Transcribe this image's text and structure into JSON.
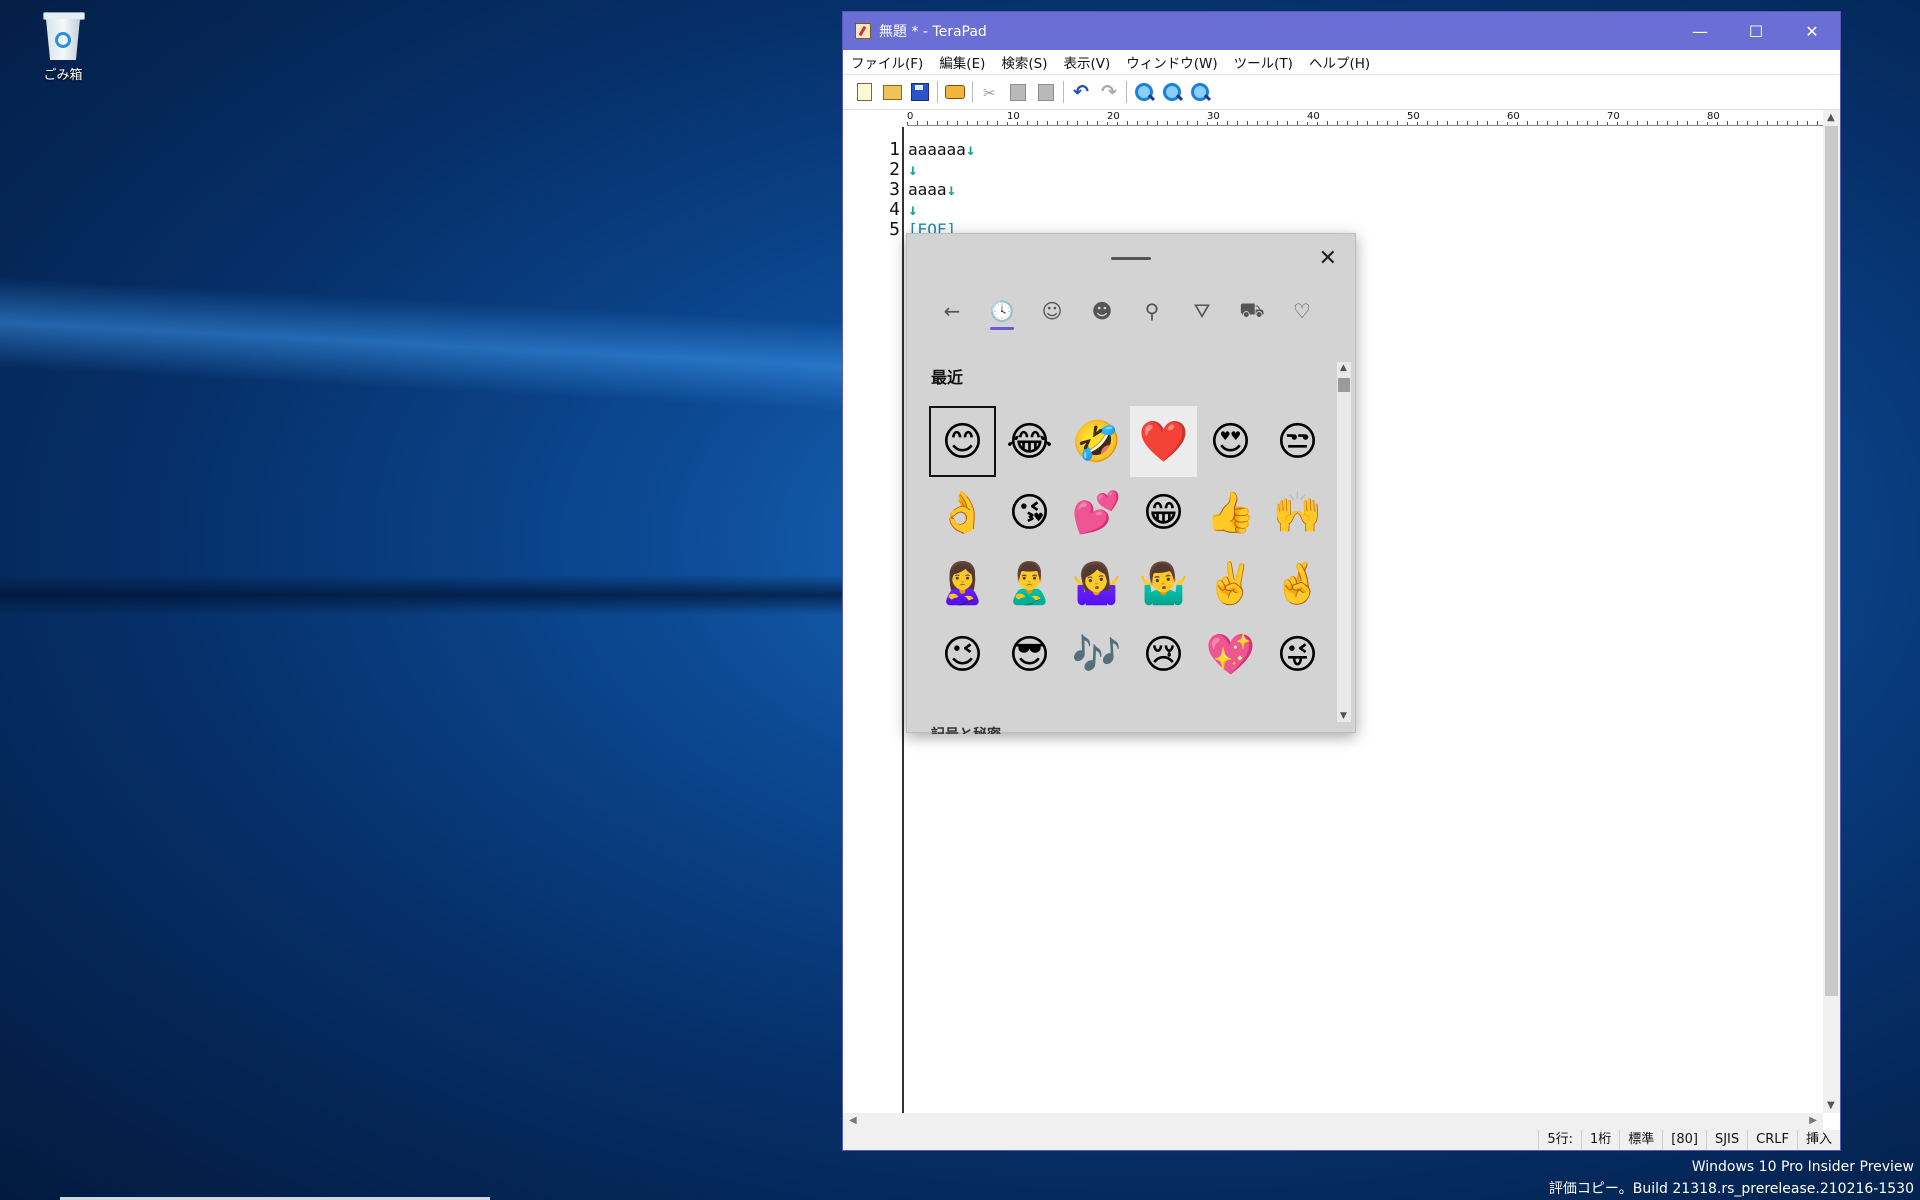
{
  "desktop": {
    "recycle_bin_label": "ごみ箱",
    "watermark_line1": "Windows 10 Pro Insider Preview",
    "watermark_line2": "評価コピー。Build 21318.rs_prerelease.210216-1530"
  },
  "window": {
    "title": "無題 * - TeraPad",
    "controls": {
      "minimize": "—",
      "maximize": "☐",
      "close": "✕"
    }
  },
  "menu": [
    "ファイル(F)",
    "編集(E)",
    "検索(S)",
    "表示(V)",
    "ウィンドウ(W)",
    "ツール(T)",
    "ヘルプ(H)"
  ],
  "ruler_ticks": [
    "0",
    "10",
    "20",
    "30",
    "40",
    "50",
    "60",
    "70",
    "80"
  ],
  "editor": {
    "line_numbers": [
      "1",
      "2",
      "3",
      "4",
      "5"
    ],
    "lines": [
      {
        "text": "aaaaaa",
        "newline": "↓"
      },
      {
        "text": "",
        "newline": "↓"
      },
      {
        "text": "aaaa",
        "newline": "↓"
      },
      {
        "text": "",
        "newline": "↓"
      }
    ],
    "eof": "[EOF]"
  },
  "emoji_panel": {
    "close_glyph": "✕",
    "tabs": [
      {
        "name": "back-arrow-icon",
        "glyph": "←"
      },
      {
        "name": "recent-clock-icon",
        "glyph": "🕓"
      },
      {
        "name": "smiley-icon",
        "glyph": "☺"
      },
      {
        "name": "people-icon",
        "glyph": "☻"
      },
      {
        "name": "celebration-icon",
        "glyph": "⚲"
      },
      {
        "name": "food-icon",
        "glyph": "⛛"
      },
      {
        "name": "car-icon",
        "glyph": "⛟"
      },
      {
        "name": "heart-icon",
        "glyph": "♡"
      }
    ],
    "section_title": "最近",
    "next_section_title": "記号と秘密",
    "emojis": [
      "😊",
      "😂",
      "🤣",
      "❤️",
      "😍",
      "😒",
      "👌",
      "😘",
      "💕",
      "😁",
      "👍",
      "🙌",
      "🙎‍♀️",
      "🙎‍♂️",
      "🤷‍♀️",
      "🤷‍♂️",
      "✌️",
      "🤞",
      "😉",
      "😎",
      "🎶",
      "😢",
      "💖",
      "😜"
    ]
  },
  "status": {
    "position": "5行:",
    "column": "1桁",
    "mode": "標準",
    "width": "[80]",
    "encoding": "SJIS",
    "line_ending": "CRLF",
    "insert": "挿入"
  }
}
